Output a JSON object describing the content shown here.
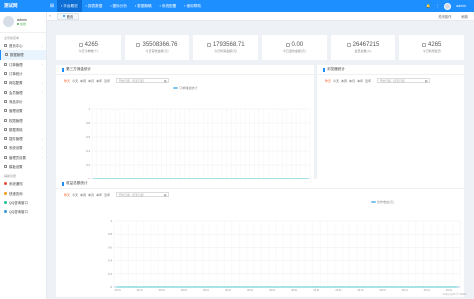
{
  "app": {
    "brand": "测试网"
  },
  "topnav": {
    "items": [
      {
        "label": "平台概况",
        "active": true
      },
      {
        "label": "报表数据",
        "active": false
      },
      {
        "label": "图标分析",
        "active": false
      },
      {
        "label": "数据概略",
        "active": false
      },
      {
        "label": "系统配置",
        "active": false
      },
      {
        "label": "使用帮助",
        "active": false
      }
    ],
    "username": "admin"
  },
  "sidebar": {
    "user": {
      "name": "admin",
      "status": "在线"
    },
    "section_main": "主导航菜单",
    "items": [
      {
        "label": "首页中心",
        "active": false,
        "arrow": true
      },
      {
        "label": "数据管理",
        "active": true,
        "arrow": false
      },
      {
        "label": "订单管理",
        "active": false,
        "arrow": true
      },
      {
        "label": "订单统计",
        "active": false,
        "arrow": false
      },
      {
        "label": "网站配置",
        "active": false,
        "arrow": true
      },
      {
        "label": "会员管理",
        "active": false,
        "arrow": true
      },
      {
        "label": "商品评价",
        "active": false,
        "arrow": false
      },
      {
        "label": "管理设置",
        "active": false,
        "arrow": false
      },
      {
        "label": "权限管理",
        "active": false,
        "arrow": false
      },
      {
        "label": "数据清除",
        "active": false,
        "arrow": false
      },
      {
        "label": "插件管理",
        "active": false,
        "arrow": true
      },
      {
        "label": "系统设置",
        "active": false,
        "arrow": true
      },
      {
        "label": "管理员设置",
        "active": false,
        "arrow": true
      },
      {
        "label": "模板设置",
        "active": false,
        "arrow": false
      }
    ],
    "section_tools": "辅助功能",
    "tools": [
      {
        "label": "系统通知",
        "color": "#e74c3c"
      },
      {
        "label": "快递查询",
        "color": "#f39c12"
      },
      {
        "label": "QQ咨询窗口",
        "color": "#1abc9c"
      },
      {
        "label": "QQ咨询窗口",
        "color": "#3498db"
      }
    ]
  },
  "tabs": {
    "current": "首页",
    "right": [
      "关闭操作",
      "刷新"
    ]
  },
  "stats": [
    {
      "value": "4265",
      "label": "今日订单数(个)"
    },
    {
      "value": "35508366.76",
      "label": "今日营收金额(元)"
    },
    {
      "value": "1793568.71",
      "label": "今日利润金额(元)"
    },
    {
      "value": "0.00",
      "label": "今日退款金额(元)"
    },
    {
      "value": "26467215",
      "label": "会员总数(人)"
    },
    {
      "value": "4265",
      "label": "今日新增会员"
    }
  ],
  "panels": {
    "orders": {
      "title": "第三方佣金统计",
      "legend": "订单佣金统计"
    },
    "browser": {
      "title": "浏览器统计"
    },
    "income": {
      "title": "收益总额统计",
      "legend": "合作收益(元)"
    }
  },
  "filter": {
    "options": [
      "昨天",
      "今天",
      "本周",
      "本月",
      "本年",
      "近年"
    ],
    "range_placeholder": "开始日期 - 结束日期",
    "calendar_icon": "calendar-icon"
  },
  "chart_data": [
    {
      "type": "line",
      "title": "第三方佣金统计",
      "series": [
        {
          "name": "订单佣金统计",
          "values": [
            0,
            0,
            0,
            0,
            0,
            0,
            0,
            0,
            0,
            0,
            0,
            0,
            0,
            0,
            0,
            0,
            0,
            0,
            0,
            0,
            0,
            0,
            0,
            0,
            0,
            0,
            0,
            0,
            0,
            0,
            0,
            0,
            0,
            0,
            0,
            0,
            0,
            0,
            0,
            0,
            0,
            0,
            0,
            0,
            0,
            0,
            0
          ]
        }
      ],
      "yticks": [
        "1",
        "0.8",
        "0.6",
        "0.4",
        "0.2",
        "0"
      ],
      "ylim": [
        0,
        1
      ],
      "x_count": 47,
      "x_label_sample": "08-01",
      "grid": true
    },
    {
      "type": "line",
      "title": "收益总额统计",
      "series": [
        {
          "name": "合作收益(元)",
          "values": [
            0,
            0,
            0,
            0,
            0,
            0,
            0,
            0,
            0,
            0,
            0,
            0,
            0,
            0,
            0,
            0,
            0,
            0,
            0,
            0,
            0,
            0,
            0,
            0,
            0,
            0,
            0,
            0,
            0,
            0,
            0,
            0,
            0,
            0,
            0,
            0,
            0,
            0,
            0,
            0,
            0,
            0,
            0,
            0,
            0,
            0,
            0
          ]
        }
      ],
      "yticks": [
        "1",
        "0.8",
        "0.6",
        "0.4",
        "0.2",
        "0"
      ],
      "ylim": [
        0,
        1
      ],
      "x_count": 47,
      "x_label_sample": "08-01",
      "grid": true
    }
  ],
  "footer": "Copyright © 2019"
}
